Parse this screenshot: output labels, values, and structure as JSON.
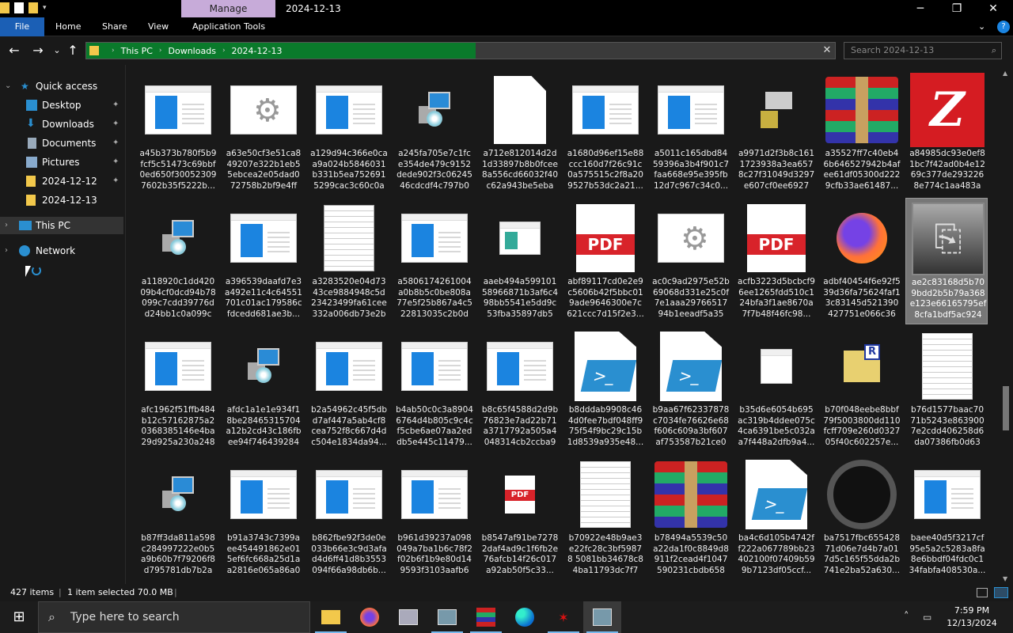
{
  "title": {
    "manage_label": "Manage",
    "window_title": "2024-12-13",
    "minimize": "─",
    "restore": "❐",
    "close": "✕"
  },
  "ribbon": {
    "tabs": [
      "File",
      "Home",
      "Share",
      "View",
      "Application Tools"
    ],
    "expand": "⌄",
    "help": "?"
  },
  "nav": {
    "back": "←",
    "forward": "→",
    "recent": "⌄",
    "up": "↑"
  },
  "address": {
    "crumbs": [
      "This PC",
      "Downloads",
      "2024-12-13"
    ],
    "sep": "›",
    "clear": "✕",
    "progress_percent": 52
  },
  "search": {
    "placeholder": "Search 2024-12-13",
    "icon": "⌕"
  },
  "sidebar": {
    "quick_access": "Quick access",
    "items": [
      {
        "label": "Desktop",
        "icon": "desktop-icon",
        "pinned": true
      },
      {
        "label": "Downloads",
        "icon": "download-icon",
        "pinned": true
      },
      {
        "label": "Documents",
        "icon": "documents-icon",
        "pinned": true
      },
      {
        "label": "Pictures",
        "icon": "pictures-icon",
        "pinned": true
      },
      {
        "label": "2024-12-12",
        "icon": "folder-icon",
        "pinned": true
      },
      {
        "label": "2024-12-13",
        "icon": "folder-icon",
        "pinned": false
      }
    ],
    "this_pc": "This PC",
    "network": "Network",
    "pin_glyph": "📌",
    "expanded_chev": "⌄",
    "collapsed_chev": "›"
  },
  "files": [
    {
      "name": "a45b373b780f5b9fcf5c51473c69bbf0ed650f300523097602b35f5222b...",
      "type": "app"
    },
    {
      "name": "a63e50cf3e51ca849207e322b1eb55ebcea2e05dad072758b2bf9e4ff4...",
      "type": "gear"
    },
    {
      "name": "a129d94c366e0caa9a024b5846031b331b5ea7526915299cac3c60c0a7...",
      "type": "app"
    },
    {
      "name": "a245fa705e7c1fce354de479c9152dede902f3c0624546cdcdf4c797b0b...",
      "type": "installer"
    },
    {
      "name": "a712e812014d2d1d33897b8b0fcee8a556cd66032f40c62a943be5eba4...",
      "type": "blank"
    },
    {
      "name": "a1680d96ef15e88ccc160d7f26c91c0a575515c2f8a209527b53dc2a21...",
      "type": "app"
    },
    {
      "name": "a5011c165dbd8459396a3b4f901c7faa668e95e395fb12d7c967c34c0...",
      "type": "app"
    },
    {
      "name": "a9971d2f3b8c1611723938a3ea6578c27f31049d3297e607cf0ee6927a...",
      "type": "setup"
    },
    {
      "name": "a35527ff7c40eb46b646527942b4afee61df05300d2229cfb33ae61487...",
      "type": "rar"
    },
    {
      "name": "a84985dc93e0ef81bc7f42ad0b4e1269c377de2932268e774c1aa483ae...",
      "type": "filezilla"
    },
    {
      "name": "a118920c1dd42009b4cf0dcd94b78099c7cdd39776dd24bb1c0a099cb...",
      "type": "installer"
    },
    {
      "name": "a396539daafd7e3a492e11c4c64551701c01ac179586cfdcedd681ae3b...",
      "type": "app"
    },
    {
      "name": "a3283520e04d7343ce9884948c5d23423499fa61cee332a006db73e2b9...",
      "type": "wordpad"
    },
    {
      "name": "a5806174261004a0b8b5c0be808a77e5f25b867a4c522813035c2b0dc...",
      "type": "app"
    },
    {
      "name": "aaeb494a59910158966871b3af6c498bb5541e5dd9c53fba35897db57...",
      "type": "window"
    },
    {
      "name": "abf89117cd0e2e9c5606b42f5bbc019ade9646300e7c621ccc7d15f2e3...",
      "type": "pdfshield"
    },
    {
      "name": "ac0c9ad2975e52b69068d331e25c0f7e1aaa2976651794b1eeadf5a352...",
      "type": "gear"
    },
    {
      "name": "acfb3223d5bcbcf96ee1265fdd510c124bfa3f1ae8670a7f7b48f46fc98...",
      "type": "pdflink"
    },
    {
      "name": "adbf40454f6e92f539d36fa75624faf13c83145d521390427751e066c36d...",
      "type": "firefox"
    },
    {
      "name": "ae2c83168d5b709bdd2b5b79a368e123e66165795ef8cfa1bdf5ac924f...",
      "type": "usb",
      "selected": true
    },
    {
      "name": "afc1962f51ffb484b12c57162875a20368385146e4ba29d925a230a2487...",
      "type": "app"
    },
    {
      "name": "afdc1a1e1e934f18be28465315704a12b2cd43c186fbee94f7464392849...",
      "type": "installer"
    },
    {
      "name": "b2a54962c45f5dbd7af447a5ab4cf8cea752f8c667d4dc504e1834da94...",
      "type": "app"
    },
    {
      "name": "b4ab50c0c3a89046764d4b805c9c4cf5cbe6ae07aa2eddb5e445c11479...",
      "type": "app"
    },
    {
      "name": "b8c65f4588d2d9b76823e7ad22b71a3717792a505a4048314cb2ccba9a...",
      "type": "app"
    },
    {
      "name": "b8dddab9908c464d0fee7bdf048ff975f54f9bc29c15b1d8539a935e48...",
      "type": "ps"
    },
    {
      "name": "b9aa67f62337878c7034fe76626e68f606c609a3bf607af753587b21ce08...",
      "type": "ps"
    },
    {
      "name": "b35d6e6054b695ac319b4ddee075c4ca6391be5c032aa7f448a2dfb9a4...",
      "type": "script"
    },
    {
      "name": "b70f048eebe8bbf79f5003800dd110fcff709e260d032705f40c602257e...",
      "type": "reg"
    },
    {
      "name": "b76d1577baac7071b5243e8639007e2cdd406258d6da07386fb0d638...",
      "type": "textdoc"
    },
    {
      "name": "b87ff3da811a598c284997222e0b5a9b60b7f79206f8d795781db7b2ab...",
      "type": "installer"
    },
    {
      "name": "b91a3743c7399aee454491862e015ef6fc668a25d1aa2816e065a86a03f...",
      "type": "app"
    },
    {
      "name": "b862fbe92f3de0e033b66e3c9d3afad4d6ff41d8b3553094f66a98db6b...",
      "type": "app"
    },
    {
      "name": "b961d39237a098049a7ba1b6c78f2f02b6f1b9e80d149593f3103aafb6b...",
      "type": "app"
    },
    {
      "name": "b8547af91be72782daf4ad9c1f6fb2e76afcb14f26c017a92ab50f5c33...",
      "type": "pdfsmall"
    },
    {
      "name": "b70922e48b9ae3e22fc28c3bf59878 5081bb34678c84ba11793dc7f70...",
      "type": "textdoc"
    },
    {
      "name": "b78494a5539c50a22da1f0c8849d8911f2cead4f1047590231cbdb6582...",
      "type": "rar"
    },
    {
      "name": "ba4c6d105b4742ff222a067789bb23402100f07409b599b7123df05ccf...",
      "type": "ps"
    },
    {
      "name": "ba7517fbc65542871d06e7d4b7a017d5c165f55dda2b741e2ba52a630...",
      "type": "ring"
    },
    {
      "name": "baee40d5f3217cf95e5a2c5283a8fa8e6bbdf04fdc0c134fabfa408530a...",
      "type": "app"
    }
  ],
  "status": {
    "items": "427 items",
    "selected": "1 item selected  70.0 MB",
    "sep": "|"
  },
  "taskbar": {
    "start_glyph": "⊞",
    "search_placeholder": "Type here to search",
    "search_glyph": "⌕",
    "apps": [
      "file-explorer",
      "firefox",
      "app-generic",
      "app-installer",
      "winrar",
      "edge",
      "mixer",
      "active-app"
    ],
    "tray_up": "˄",
    "time": "7:59 PM",
    "date": "12/13/2024"
  }
}
